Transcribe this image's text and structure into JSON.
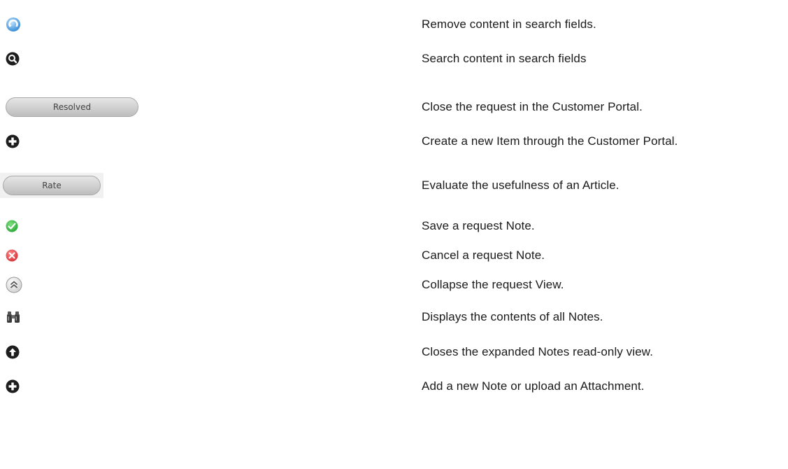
{
  "rows": [
    {
      "icon": "refresh-icon",
      "description": "Remove content in search fields."
    },
    {
      "icon": "search-icon",
      "description": "Search content in search fields"
    },
    {
      "icon": "resolved-button",
      "label": "Resolved",
      "description": "Close the request in the Customer Portal."
    },
    {
      "icon": "plus-icon",
      "description": "Create a new Item through the Customer Portal."
    },
    {
      "icon": "rate-button",
      "label": "Rate",
      "description": "Evaluate the usefulness of an Article."
    },
    {
      "icon": "check-icon",
      "description": "Save a request Note."
    },
    {
      "icon": "cancel-icon",
      "description": "Cancel a request Note."
    },
    {
      "icon": "collapse-icon",
      "description": "Collapse the request View."
    },
    {
      "icon": "binoculars-icon",
      "description": "Displays the contents of all Notes."
    },
    {
      "icon": "arrow-up-icon",
      "description": "Closes the expanded Notes read-only view."
    },
    {
      "icon": "plus-icon",
      "description": "Add a new Note or upload an Attachment."
    }
  ],
  "colors": {
    "refresh": "#3b8fd8",
    "dark_icon": "#1e1e1e",
    "check": "#2eaa3a",
    "cancel": "#d9343b",
    "collapse": "#9a9a9a"
  }
}
